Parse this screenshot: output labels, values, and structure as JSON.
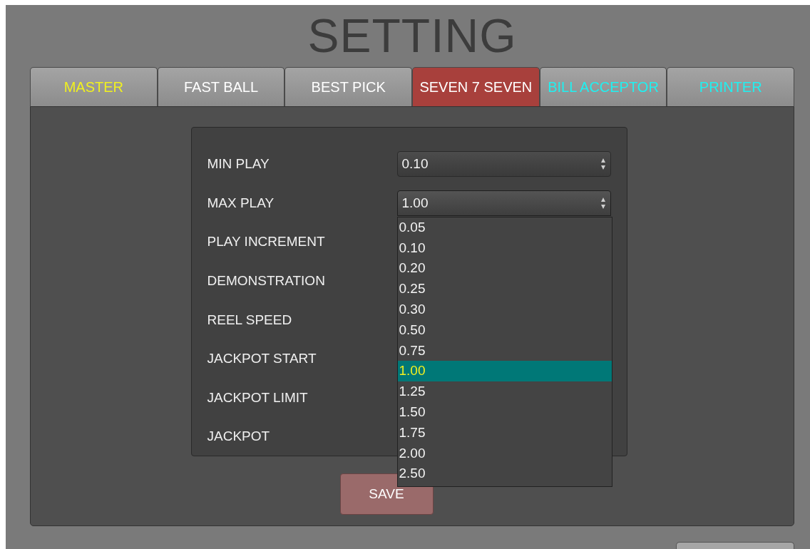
{
  "title": "SETTING",
  "tabs": [
    {
      "label": "MASTER",
      "selected": false,
      "kind": "main"
    },
    {
      "label": "FAST BALL",
      "selected": false,
      "kind": "game"
    },
    {
      "label": "BEST PICK",
      "selected": false,
      "kind": "game"
    },
    {
      "label": "SEVEN 7 SEVEN",
      "selected": true,
      "kind": "game"
    },
    {
      "label": "BILL ACCEPTOR",
      "selected": false,
      "kind": "device"
    },
    {
      "label": "PRINTER",
      "selected": false,
      "kind": "device"
    }
  ],
  "settings": [
    {
      "label": "MIN PLAY",
      "value": "0.10"
    },
    {
      "label": "MAX PLAY",
      "value": "1.00",
      "expanded": true
    },
    {
      "label": "PLAY INCREMENT"
    },
    {
      "label": "DEMONSTRATION"
    },
    {
      "label": "REEL SPEED"
    },
    {
      "label": "JACKPOT START"
    },
    {
      "label": "JACKPOT LIMIT"
    },
    {
      "label": "JACKPOT"
    }
  ],
  "dropdown_options": [
    {
      "label": "0.05",
      "selected": false
    },
    {
      "label": "0.10",
      "selected": false
    },
    {
      "label": "0.20",
      "selected": false
    },
    {
      "label": "0.25",
      "selected": false
    },
    {
      "label": "0.30",
      "selected": false
    },
    {
      "label": "0.50",
      "selected": false
    },
    {
      "label": "0.75",
      "selected": false
    },
    {
      "label": "1.00",
      "selected": true
    },
    {
      "label": "1.25",
      "selected": false
    },
    {
      "label": "1.50",
      "selected": false
    },
    {
      "label": "1.75",
      "selected": false
    },
    {
      "label": "2.00",
      "selected": false
    },
    {
      "label": "2.50",
      "selected": false
    }
  ],
  "save_button": "SAVE"
}
